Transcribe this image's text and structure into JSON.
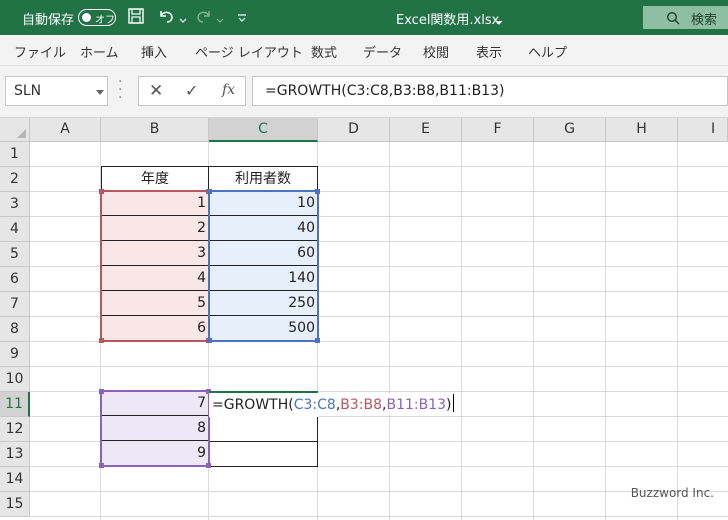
{
  "titlebar": {
    "autosave_label": "自動保存",
    "autosave_state": "オフ",
    "filename": "Excel関数用.xlsx",
    "search_label": "検索"
  },
  "menu": [
    "ファイル",
    "ホーム",
    "挿入",
    "ページ レイアウト",
    "数式",
    "データ",
    "校閲",
    "表示",
    "ヘルプ"
  ],
  "formula_bar": {
    "name_box": "SLN",
    "formula": "=GROWTH(C3:C8,B3:B8,B11:B13)"
  },
  "columns": [
    "A",
    "B",
    "C",
    "D",
    "E",
    "F",
    "G",
    "H",
    "I"
  ],
  "rows": [
    "1",
    "2",
    "3",
    "4",
    "5",
    "6",
    "7",
    "8",
    "9",
    "10",
    "11",
    "12",
    "13",
    "14",
    "15"
  ],
  "table": {
    "header_year": "年度",
    "header_users": "利用者数",
    "years": [
      "1",
      "2",
      "3",
      "4",
      "5",
      "6"
    ],
    "users": [
      "10",
      "40",
      "60",
      "140",
      "250",
      "500"
    ]
  },
  "new_x": [
    "7",
    "8",
    "9"
  ],
  "editing_formula": {
    "prefix": "=GROWTH(",
    "ref1": "C3:C8",
    "sep1": ",",
    "ref2": "B3:B8",
    "sep2": ",",
    "ref3": "B11:B13",
    "suffix": ")"
  },
  "watermark": "Buzzword Inc.",
  "colors": {
    "excel_green": "#217346",
    "ref_red": "#b5575e",
    "ref_blue": "#4a73c1",
    "ref_purple": "#8b62b8",
    "fill_red": "#f9e6e7",
    "fill_blue": "#e7effa",
    "fill_purple": "#eee7f6"
  }
}
